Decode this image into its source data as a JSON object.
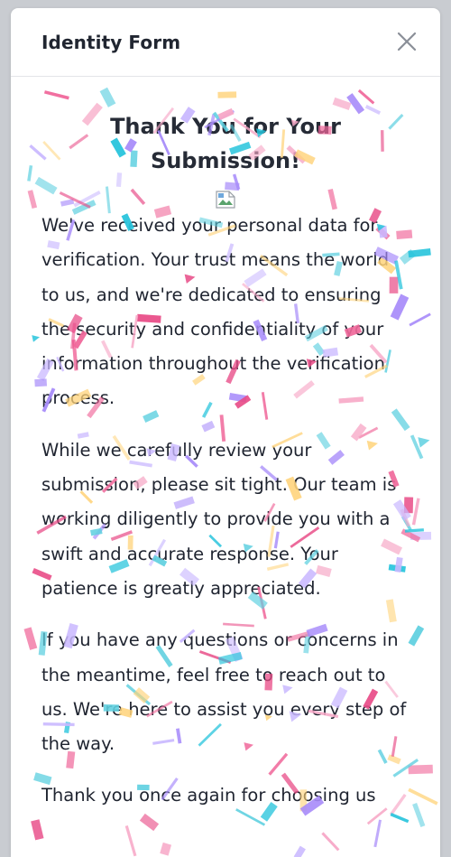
{
  "modal": {
    "title": "Identity Form",
    "close_icon": "close-icon"
  },
  "body": {
    "heading": "Thank You for Your Submission!",
    "image_icon": "broken-image-icon",
    "paragraphs": [
      "We've received your personal data for verification. Your trust means the world to us, and we're dedicated to ensuring the security and confidentiality of your information throughout the verification process.",
      "While we carefully review your submission, please sit tight. Our team is working diligently to provide you with a swift and accurate response. Your patience is greatly appreciated.",
      "If you have any questions or concerns in the meantime, feel free to reach out to us. We're here to assist you every step of the way.",
      "Thank you once again for choosing us"
    ]
  },
  "confetti_colors": [
    "#f0679a",
    "#a78bfa",
    "#5fd0e0",
    "#ffd37a",
    "#e84a86",
    "#c9b8ff",
    "#27c4dc",
    "#f7a8c7"
  ]
}
